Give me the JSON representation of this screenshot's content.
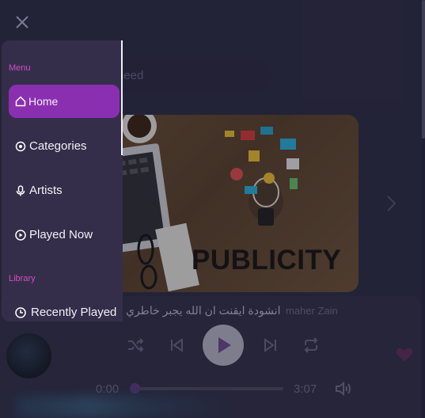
{
  "search": {
    "placeholder": "heed"
  },
  "hero": {
    "image_text": "PUBLICITY"
  },
  "drawer": {
    "menu_label": "Menu",
    "library_label": "Library",
    "items": [
      {
        "label": "Home",
        "icon": "home-icon",
        "active": true
      },
      {
        "label": "Categories",
        "icon": "target-icon",
        "active": false
      },
      {
        "label": "Artists",
        "icon": "microphone-icon",
        "active": false
      },
      {
        "label": "Played Now",
        "icon": "play-circle-icon",
        "active": false
      }
    ],
    "library_items": [
      {
        "label": "Recently Played",
        "icon": "clock-icon"
      }
    ]
  },
  "player": {
    "title": "انشودة ايقنت ان الله يجبر خاطري",
    "artist": "maher Zain",
    "time_current": "0:00",
    "time_total": "3:07",
    "progress": 0.0
  },
  "colors": {
    "accent": "#8b2fb1",
    "section_label": "#d04fc7",
    "background": "#2c2b44",
    "drawer": "#352e4a"
  }
}
